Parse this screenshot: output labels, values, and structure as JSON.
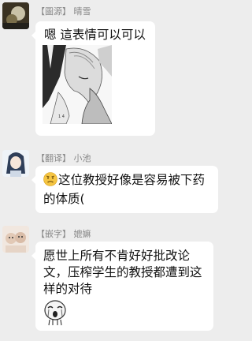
{
  "messages": [
    {
      "sender_tag": "【圖源】",
      "sender_name": "晴雪",
      "text": "嗯 這表情可以可以",
      "has_image": true,
      "image_alt": "manga-panel-sticker"
    },
    {
      "sender_tag": "【翻译】",
      "sender_name": "小池",
      "emoji": "worried-face",
      "lines": [
        "这位教授好像是容易被下药",
        "的体质("
      ]
    },
    {
      "sender_tag": "【嵌字】",
      "sender_name": "媲嫲",
      "lines": [
        "愿世上所有不肯好好批改论",
        "文，压榨学生的教授都遭到这",
        "样的对待"
      ],
      "sticker": "crying-face-sticker"
    }
  ],
  "colors": {
    "background": "#ededed",
    "bubble": "#ffffff",
    "sender_text": "#888888",
    "message_text": "#111111",
    "emoji_fill": "#f5c542"
  }
}
